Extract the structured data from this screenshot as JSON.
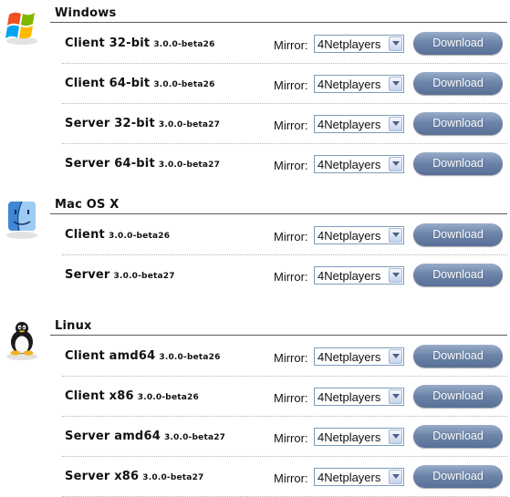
{
  "mirror_label": "Mirror:",
  "download_label": "Download",
  "sections": [
    {
      "title": "Windows",
      "icon": "windows-logo-icon",
      "items": [
        {
          "name": "Client 32-bit",
          "version": "3.0.0-beta26",
          "mirror": "4Netplayers"
        },
        {
          "name": "Client 64-bit",
          "version": "3.0.0-beta26",
          "mirror": "4Netplayers"
        },
        {
          "name": "Server 32-bit",
          "version": "3.0.0-beta27",
          "mirror": "4Netplayers"
        },
        {
          "name": "Server 64-bit",
          "version": "3.0.0-beta27",
          "mirror": "4Netplayers"
        }
      ]
    },
    {
      "title": "Mac OS X",
      "icon": "mac-finder-icon",
      "items": [
        {
          "name": "Client",
          "version": "3.0.0-beta26",
          "mirror": "4Netplayers"
        },
        {
          "name": "Server",
          "version": "3.0.0-beta27",
          "mirror": "4Netplayers"
        }
      ]
    },
    {
      "title": "Linux",
      "icon": "linux-tux-icon",
      "items": [
        {
          "name": "Client amd64",
          "version": "3.0.0-beta26",
          "mirror": "4Netplayers"
        },
        {
          "name": "Client x86",
          "version": "3.0.0-beta26",
          "mirror": "4Netplayers"
        },
        {
          "name": "Server amd64",
          "version": "3.0.0-beta27",
          "mirror": "4Netplayers"
        },
        {
          "name": "Server x86",
          "version": "3.0.0-beta27",
          "mirror": "4Netplayers"
        }
      ]
    }
  ]
}
